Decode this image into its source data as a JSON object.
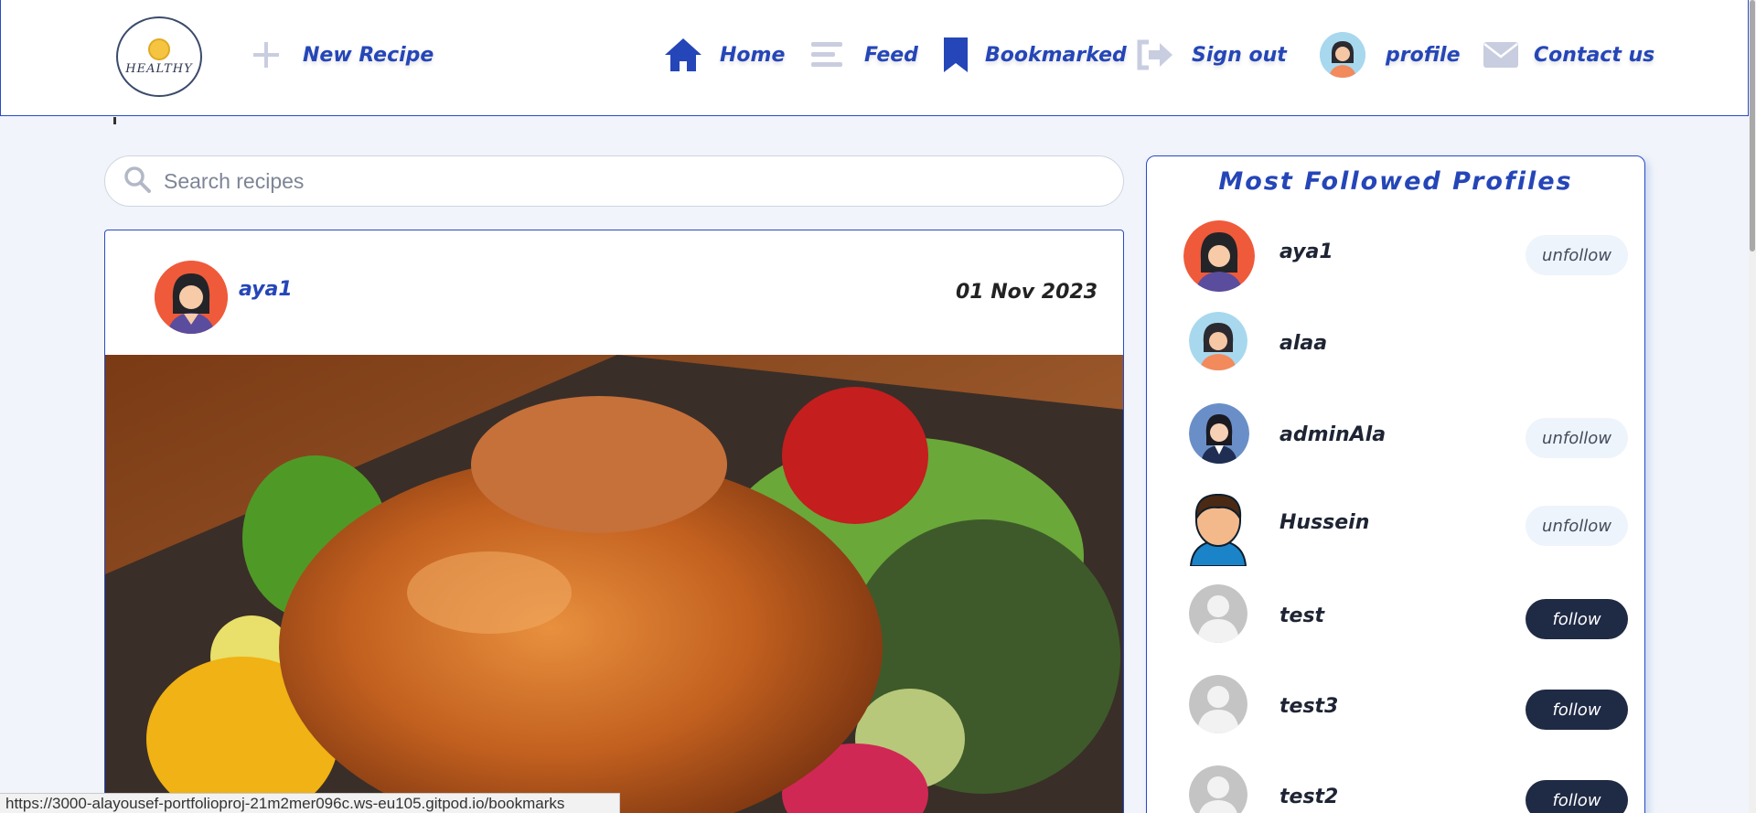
{
  "header": {
    "logo_text": "HEALTHY",
    "new_recipe_label": "New Recipe",
    "nav": [
      {
        "label": "Home",
        "icon": "home-icon"
      },
      {
        "label": "Feed",
        "icon": "feed-icon"
      },
      {
        "label": "Bookmarked",
        "icon": "bookmark-icon"
      },
      {
        "label": "Sign out",
        "icon": "sign-out-icon"
      },
      {
        "label": "profile",
        "icon": "avatar"
      },
      {
        "label": "Contact us",
        "icon": "envelope-icon"
      }
    ],
    "accent_color": "#2546b8"
  },
  "search": {
    "placeholder": "Search recipes"
  },
  "post": {
    "username": "aya1",
    "date": "01 Nov 2023",
    "image": "roast-chicken-with-vegetables"
  },
  "sidebar": {
    "title": "Most Followed Profiles",
    "profiles": [
      {
        "name": "aya1",
        "button": "unfollow",
        "avatar": "woman-red-bg"
      },
      {
        "name": "alaa",
        "button": "",
        "avatar": "woman-blue-bg"
      },
      {
        "name": "adminAla",
        "button": "unfollow",
        "avatar": "woman-suit"
      },
      {
        "name": "Hussein",
        "button": "unfollow",
        "avatar": "man-cartoon"
      },
      {
        "name": "test",
        "button": "follow",
        "avatar": "default-avatar"
      },
      {
        "name": "test3",
        "button": "follow",
        "avatar": "default-avatar"
      },
      {
        "name": "test2",
        "button": "follow",
        "avatar": "default-avatar"
      }
    ]
  },
  "status_url": "https://3000-alayousef-portfolioproj-21m2mer096c.ws-eu105.gitpod.io/bookmarks"
}
